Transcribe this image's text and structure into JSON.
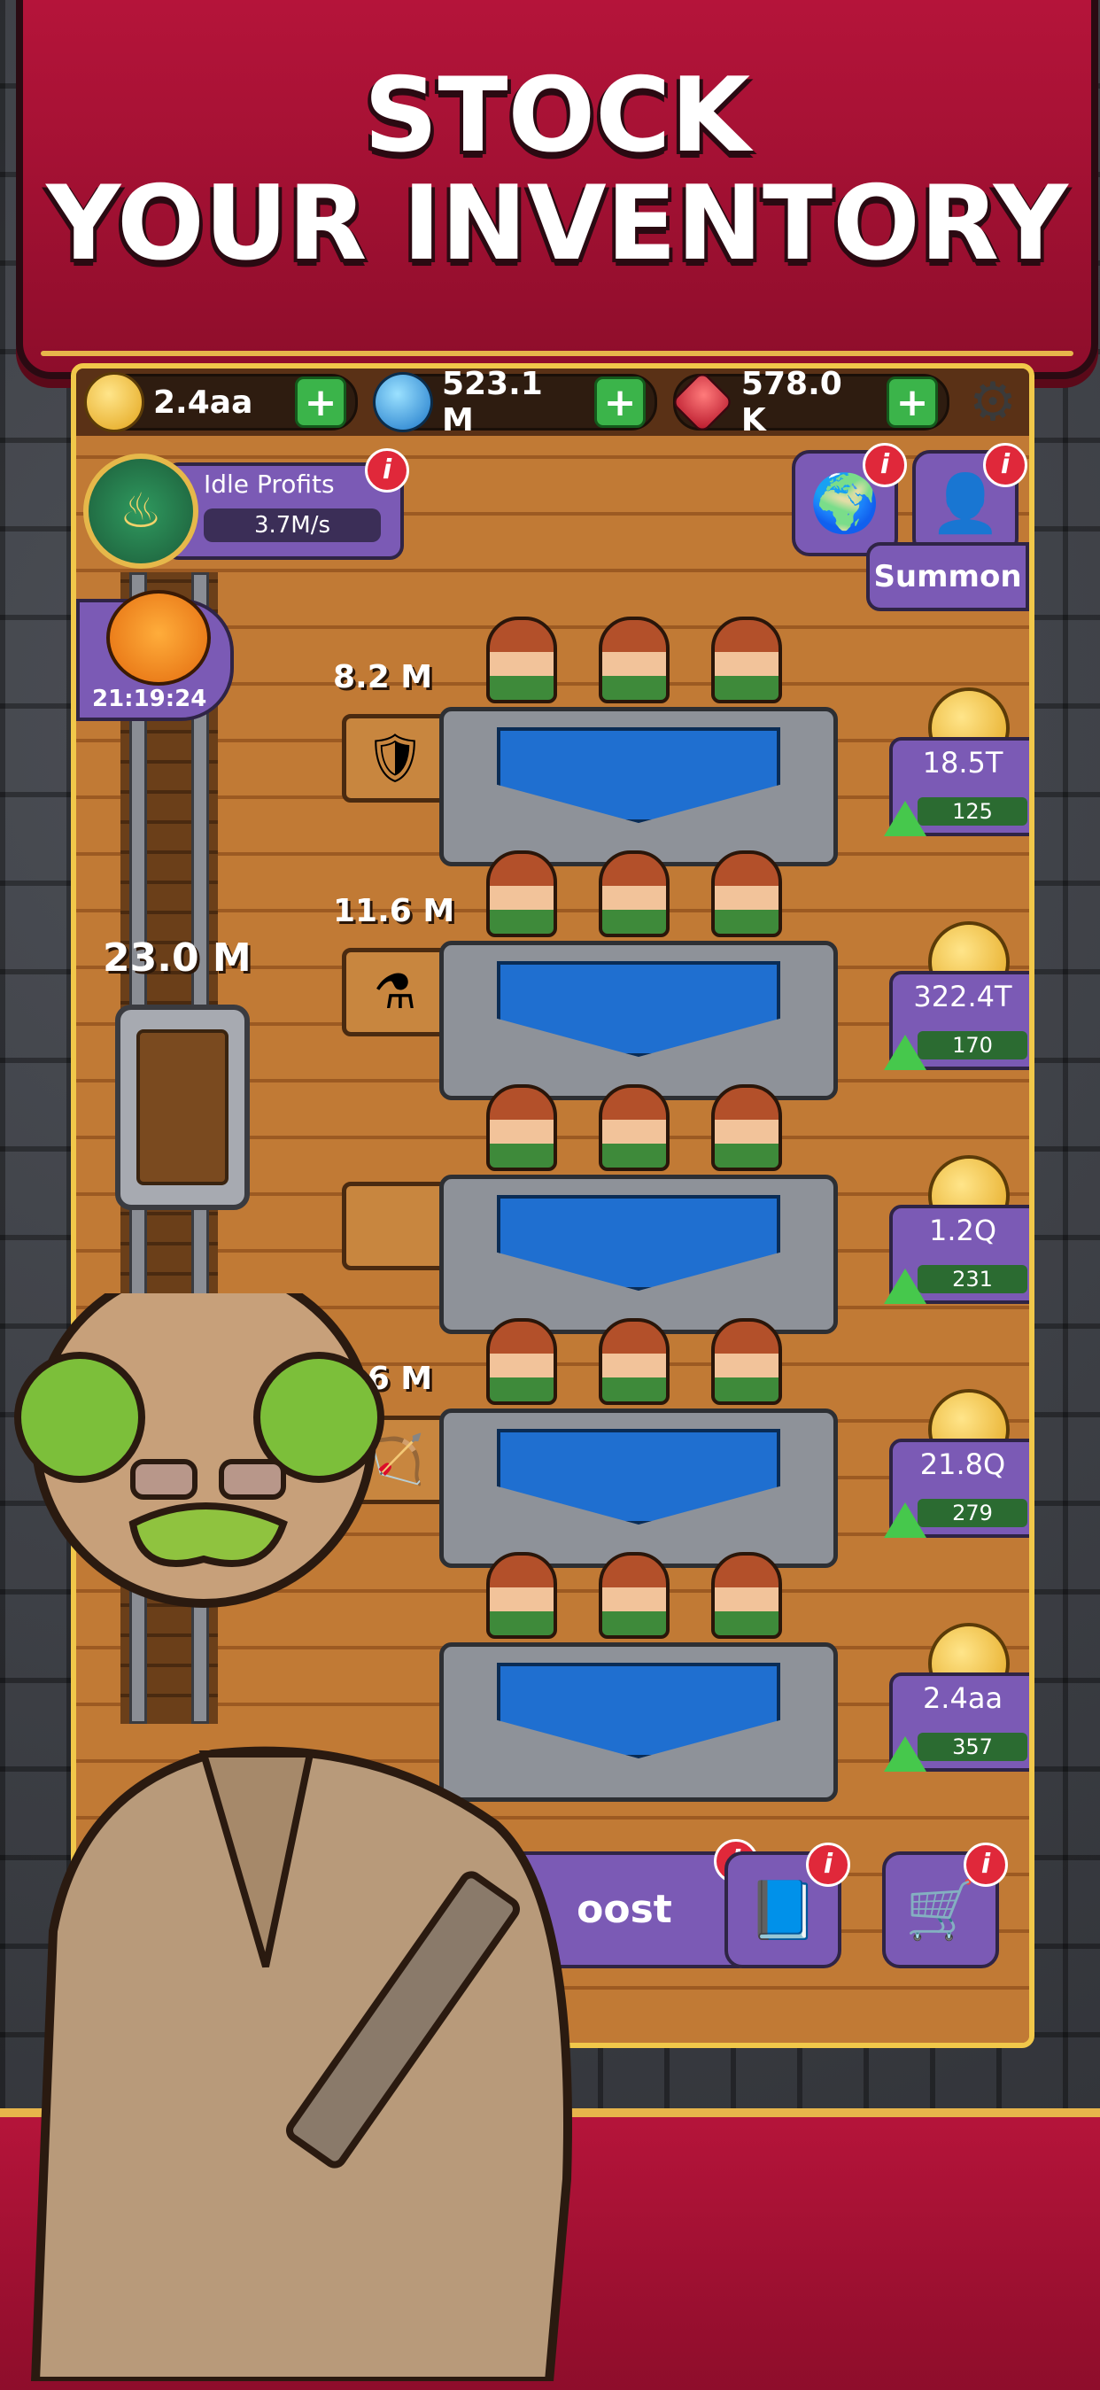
{
  "banner": {
    "title": "STOCK\nYOUR INVENTORY"
  },
  "topbar": {
    "coins": "2.4aa",
    "water": "523.1 M",
    "gems": "578.0 K",
    "plus": "+"
  },
  "idle_profits": {
    "title": "Idle Profits",
    "rate": "3.7M/s"
  },
  "summon": {
    "label": "Summon"
  },
  "cat": {
    "timer": "21:19:24"
  },
  "cart": {
    "amount": "23.0 M"
  },
  "rows": [
    {
      "amount": "8.2 M",
      "item_icon": "shield-icon",
      "item_glyph": "🛡",
      "earn": "18.5T",
      "level": "125"
    },
    {
      "amount": "11.6 M",
      "item_icon": "potion-icon",
      "item_glyph": "⚗",
      "earn": "322.4T",
      "level": "170"
    },
    {
      "amount": "",
      "item_icon": "spellbook-icon",
      "item_glyph": "📘",
      "earn": "1.2Q",
      "level": "231"
    },
    {
      "amount": "2.6 M",
      "item_icon": "crossbow-icon",
      "item_glyph": "🏹",
      "earn": "21.8Q",
      "level": "279"
    },
    {
      "amount": "",
      "item_icon": "club-icon",
      "item_glyph": "🏏",
      "earn": "2.4aa",
      "level": "357"
    }
  ],
  "bottom": {
    "boost_label": "oost"
  },
  "info_glyph": "i",
  "colors": {
    "banner": "#b5143a",
    "panel": "#7b5ab5",
    "accent_gold": "#f1c84a",
    "plus_green": "#3bb44a"
  }
}
